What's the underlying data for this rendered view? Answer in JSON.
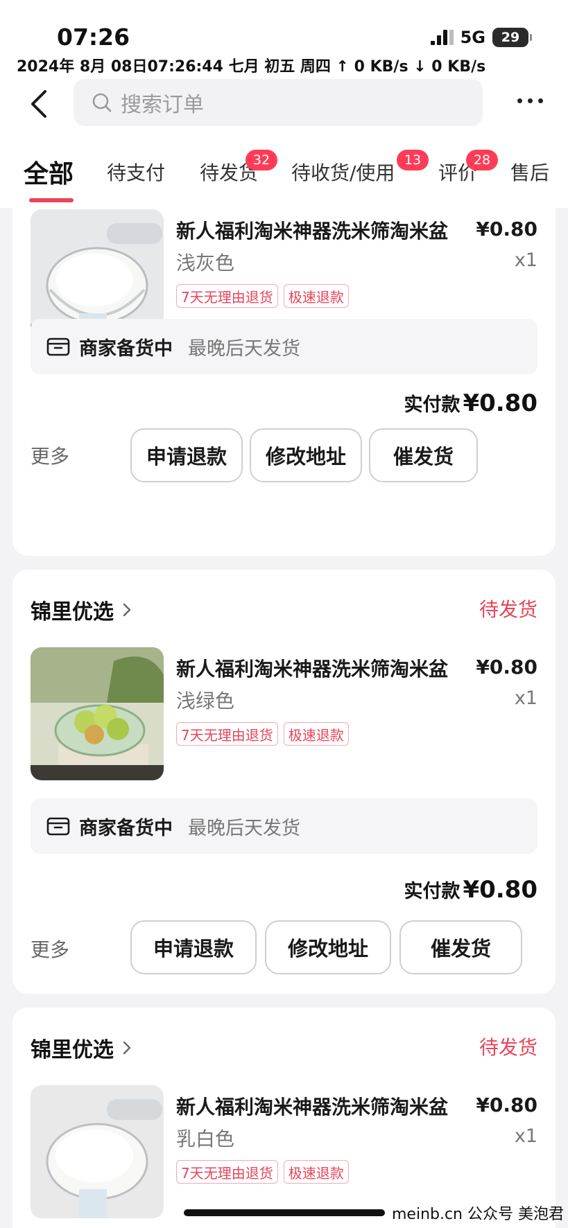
{
  "status_bar": {
    "time": "07:26",
    "network": "5G",
    "battery": "29",
    "info_line": "2024年 8月 08日07:26:44  七月 初五  周四   ↑ 0 KB/s   ↓ 0 KB/s"
  },
  "header": {
    "search_placeholder": "搜索订单"
  },
  "tabs": [
    {
      "label": "全部",
      "active": true
    },
    {
      "label": "待支付"
    },
    {
      "label": "待发货",
      "badge": "32"
    },
    {
      "label": "待收货/使用",
      "badge": "13"
    },
    {
      "label": "评价",
      "badge": "28"
    },
    {
      "label": "售后"
    }
  ],
  "orders": [
    {
      "shop": "",
      "status": "",
      "title": "新人福利淘米神器洗米筛淘米盆",
      "price": "¥0.80",
      "variant": "浅灰色",
      "qty": "x1",
      "tags": [
        "7天无理由退货",
        "极速退款"
      ],
      "ship_status": "商家备货中",
      "ship_note": "最晚后天发货",
      "paid_label": "实付款",
      "paid_value": "¥0.80",
      "more": "更多",
      "buttons": [
        "申请退款",
        "修改地址",
        "催发货"
      ]
    },
    {
      "shop": "锦里优选",
      "status": "待发货",
      "title": "新人福利淘米神器洗米筛淘米盆",
      "price": "¥0.80",
      "variant": "浅绿色",
      "qty": "x1",
      "tags": [
        "7天无理由退货",
        "极速退款"
      ],
      "ship_status": "商家备货中",
      "ship_note": "最晚后天发货",
      "paid_label": "实付款",
      "paid_value": "¥0.80",
      "more": "更多",
      "buttons": [
        "申请退款",
        "修改地址",
        "催发货"
      ]
    },
    {
      "shop": "锦里优选",
      "status": "待发货",
      "title": "新人福利淘米神器洗米筛淘米盆",
      "price": "¥0.80",
      "variant": "乳白色",
      "qty": "x1",
      "tags": [
        "7天无理由退货",
        "极速退款"
      ]
    }
  ],
  "watermark": "meinb.cn  公众号 美泡君",
  "colors": {
    "accent": "#e8445a",
    "badge": "#ff3c57",
    "background": "#f3f3f5"
  }
}
